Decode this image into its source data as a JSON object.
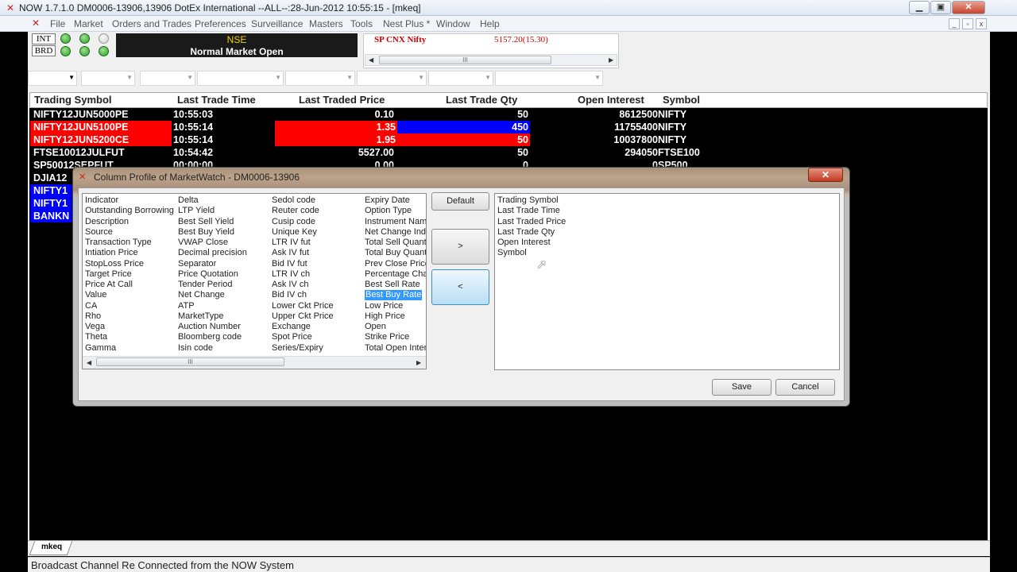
{
  "window": {
    "title": "NOW 1.7.1.0 DM0006-13906,13906 DotEx International --ALL--:28-Jun-2012 10:55:15 - [mkeq]",
    "min_label": "▁",
    "max_label": "▣",
    "close_label": "✕"
  },
  "menu": {
    "items": [
      "File",
      "Market",
      "Orders and Trades",
      "Preferences",
      "Surveillance",
      "Masters",
      "Tools",
      "Nest Plus *",
      "Window",
      "Help"
    ],
    "mdi_min": "_",
    "mdi_restore": "▫",
    "mdi_close": "x"
  },
  "market_status": {
    "segments": [
      "INT",
      "BRD"
    ],
    "exchange": "NSE",
    "status": "Normal Market Open"
  },
  "ticker": {
    "name": "SP CNX Nifty",
    "value": "5157.20(15.30)",
    "thumb": "III"
  },
  "market_watch": {
    "columns": [
      "Trading Symbol",
      "Last Trade Time",
      "Last Traded Price",
      "Last Trade Qty",
      "Open Interest",
      "Symbol"
    ],
    "rows": [
      {
        "symbol": "NIFTY12JUN5000PE",
        "time": "10:55:03",
        "price": "0.10",
        "qty": "50",
        "oi": "8612500",
        "sym": "NIFTY"
      },
      {
        "symbol": "NIFTY12JUN5100PE",
        "time": "10:55:14",
        "price": "1.35",
        "qty": "450",
        "oi": "11755400",
        "sym": "NIFTY"
      },
      {
        "symbol": "NIFTY12JUN5200CE",
        "time": "10:55:14",
        "price": "1.95",
        "qty": "50",
        "oi": "10037800",
        "sym": "NIFTY"
      },
      {
        "symbol": "FTSE10012JULFUT",
        "time": "10:54:42",
        "price": "5527.00",
        "qty": "50",
        "oi": "294050",
        "sym": "FTSE100"
      },
      {
        "symbol": "SP50012SEPFUT",
        "time": "00:00:00",
        "price": "0.00",
        "qty": "0",
        "oi": "0",
        "sym": "SP500"
      },
      {
        "symbol": "DJIA12",
        "time": "",
        "price": "",
        "qty": "",
        "oi": "",
        "sym": ""
      },
      {
        "symbol": "NIFTY1",
        "time": "",
        "price": "",
        "qty": "",
        "oi": "",
        "sym": ""
      },
      {
        "symbol": "NIFTY1",
        "time": "",
        "price": "",
        "qty": "",
        "oi": "",
        "sym": ""
      },
      {
        "symbol": "BANKN",
        "time": "",
        "price": "",
        "qty": "",
        "oi": "",
        "sym": ""
      }
    ]
  },
  "dialog": {
    "title": "Column Profile of MarketWatch - DM0006-13906",
    "close_label": "✕",
    "available_columns": [
      [
        "Indicator",
        "Outstanding Borrowings",
        "Description",
        "Source",
        "Transaction Type",
        "Intiation Price",
        "StopLoss Price",
        "Target Price",
        "Price At Call",
        "Value",
        "CA",
        "Rho",
        "Vega",
        "Theta",
        "Gamma"
      ],
      [
        "Delta",
        "LTP Yield",
        "Best Sell Yield",
        "Best Buy Yield",
        "VWAP Close",
        "Decimal precision",
        "Separator",
        "Price  Quotation",
        "Tender Period",
        "Net Change",
        "ATP",
        "MarketType",
        "Auction Number",
        "Bloomberg code",
        "Isin code"
      ],
      [
        "Sedol code",
        "Reuter code",
        "Cusip code",
        "Unique Key",
        "LTR IV fut",
        "Ask IV fut",
        "Bid IV fut",
        "LTR IV ch",
        "Ask IV ch",
        "Bid IV ch",
        "Lower Ckt Price",
        "Upper Ckt Price",
        "Exchange",
        "Spot Price",
        "Series/Expiry"
      ],
      [
        "Expiry Date",
        "Option Type",
        "Instrument Name",
        "Net Change Indicator",
        "Total Sell Quantity",
        "Total Buy Quantity",
        "Prev Close Price",
        "Percentage Change",
        "Best Sell Rate",
        "Best Buy Rate",
        "Low Price",
        "High Price",
        "Open",
        "Strike Price",
        "Total Open Interest"
      ]
    ],
    "selected_available": "Best Buy Rate",
    "selected_columns": [
      "Trading Symbol",
      "Last Trade Time",
      "Last Traded Price",
      "Last Trade Qty",
      "Open Interest",
      "Symbol"
    ],
    "default_label": "Default",
    "add_label": ">",
    "remove_label": "<",
    "save_label": "Save",
    "cancel_label": "Cancel",
    "scroll_thumb": "III"
  },
  "tabs": {
    "active": "mkeq"
  },
  "status": {
    "text": "Broadcast Channel Re Connected from the NOW System"
  },
  "colors": {
    "red": "#ff0000",
    "blue": "#0000ff",
    "led_green": "#2c9b2a"
  }
}
